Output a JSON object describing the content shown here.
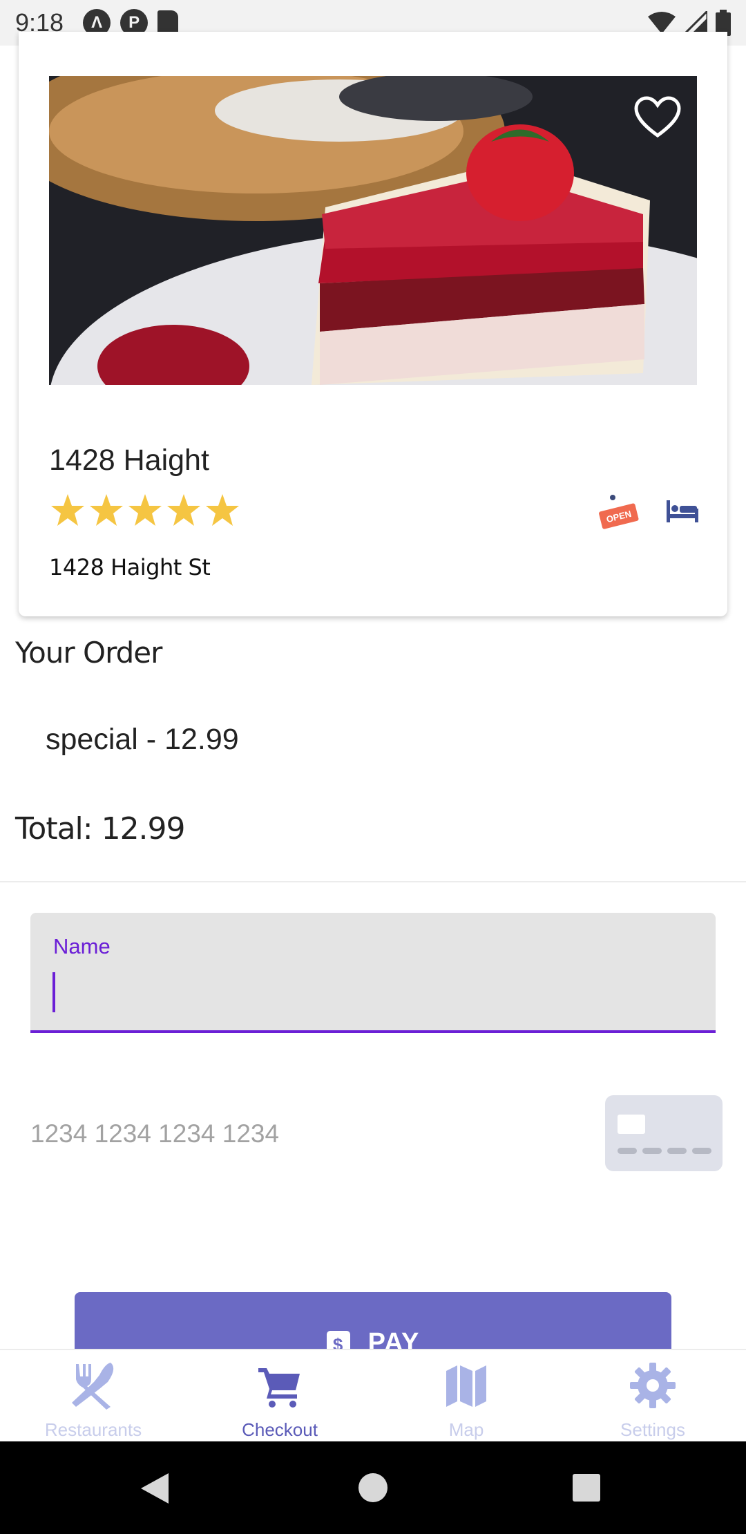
{
  "status_bar": {
    "time": "9:18"
  },
  "restaurant": {
    "name": "1428 Haight",
    "address": "1428 Haight St",
    "rating": 5,
    "rating_max": 5,
    "open_sign_text": "OPEN"
  },
  "order": {
    "heading": "Your Order",
    "items": [
      "special - 12.99"
    ],
    "total": "Total: 12.99"
  },
  "payment": {
    "name_label": "Name",
    "name_value": "",
    "card_placeholder": "1234 1234 1234 1234",
    "pay_label": "PAY",
    "pay_icon_glyph": "$"
  },
  "bottom_nav": {
    "items": [
      {
        "label": "Restaurants",
        "icon": "utensils-icon"
      },
      {
        "label": "Checkout",
        "icon": "cart-icon"
      },
      {
        "label": "Map",
        "icon": "map-icon"
      },
      {
        "label": "Settings",
        "icon": "gear-icon"
      }
    ],
    "active": "Checkout"
  },
  "colors": {
    "accent": "#6b1fd6",
    "button": "#6b6ac4",
    "nav_active": "#5b5bb8",
    "nav_inactive": "#c8cdeb",
    "star": "#f5c542"
  }
}
